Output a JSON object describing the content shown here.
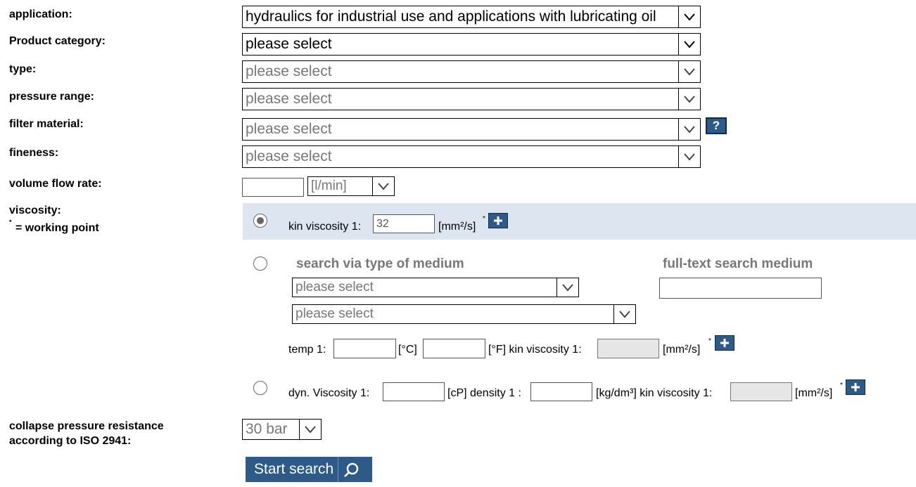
{
  "labels": {
    "application": "application:",
    "product_category": "Product category:",
    "type": "type:",
    "pressure_range": "pressure range:",
    "filter_material": "filter material:",
    "fineness": "fineness:",
    "volume_flow_rate": "volume flow rate:",
    "viscosity": "viscosity:",
    "working_point": "= working point",
    "working_point_mark": "*",
    "collapse_line1": "collapse pressure resistance",
    "collapse_line2": "according to ISO 2941:"
  },
  "selects": {
    "application": "hydraulics for industrial use and applications with lubricating oil",
    "product_category": "please select",
    "type": "please select",
    "pressure_range": "please select",
    "filter_material": "please select",
    "fineness": "please select",
    "flow_unit": "[l/min]",
    "medium_type_1": "please select",
    "medium_type_2": "please select",
    "collapse_pressure": "30 bar"
  },
  "help_label": "?",
  "viscosity": {
    "option1": {
      "kin_label": "kin viscosity 1:",
      "kin_value": "32",
      "unit": "[mm²/s]",
      "mark": "*"
    },
    "option2": {
      "heading": "search via type of medium",
      "fulltext_heading": "full-text search medium",
      "temp_label": "temp 1:",
      "unit_c": "[°C]",
      "unit_f_kin": "[°F] kin viscosity 1:",
      "unit_mm": "[mm²/s]",
      "mark": "*"
    },
    "option3": {
      "dyn_label": "dyn. Viscosity 1:",
      "cp_density": "[cP] density 1 :",
      "kg_kin": "[kg/dm³] kin viscosity 1:",
      "unit_mm": "[mm²/s]",
      "mark": "*"
    },
    "selected_option": 1
  },
  "search_button": "Start search",
  "icons": {
    "chevron": "chevron-down-icon",
    "plus": "plus-icon",
    "help": "help-icon",
    "search": "magnifier-icon"
  },
  "colors": {
    "accent": "#2d5a86",
    "highlight_band": "#dde6f0"
  }
}
